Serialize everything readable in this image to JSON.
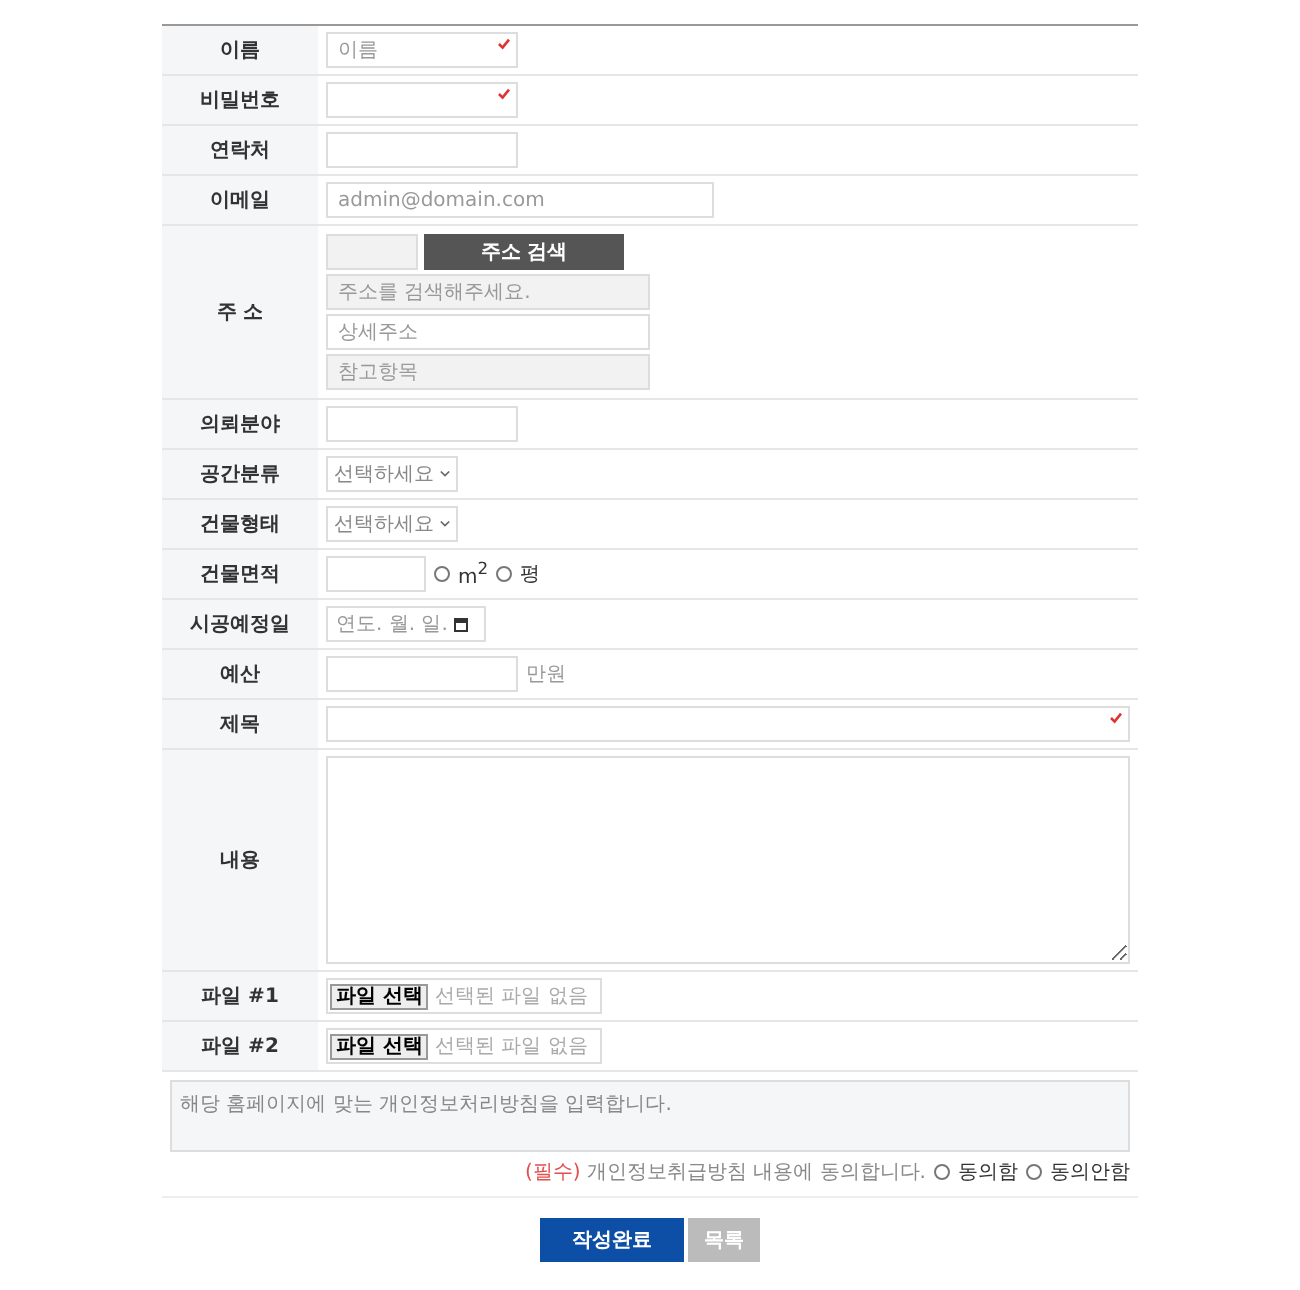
{
  "form_rows": [
    {
      "label": "이름",
      "kind": "text",
      "placeholder": "이름",
      "required": true
    },
    {
      "label": "비밀번호",
      "kind": "text",
      "required": true
    },
    {
      "label": "연락처",
      "kind": "text",
      "required": false
    },
    {
      "label": "이메일",
      "kind": "email",
      "placeholder": "admin@domain.com",
      "required": false
    },
    {
      "label": "주 소",
      "kind": "address",
      "button": "주소 검색",
      "fields": [
        {
          "placeholder": "주소를 검색해주세요.",
          "readonly": true
        },
        {
          "placeholder": "상세주소",
          "readonly": false
        },
        {
          "placeholder": "참고항목",
          "readonly": true
        }
      ]
    },
    {
      "label": "의뢰분야",
      "kind": "text",
      "required": false
    },
    {
      "label": "공간분류",
      "kind": "select",
      "value": "선택하세요"
    },
    {
      "label": "건물형태",
      "kind": "select",
      "value": "선택하세요"
    },
    {
      "label": "건물면적",
      "kind": "area",
      "options": [
        {
          "label": "m$^{2}$",
          "selected": false
        },
        {
          "label": "평",
          "selected": false
        }
      ]
    },
    {
      "label": "시공예정일",
      "kind": "date",
      "placeholder": "연도. 월. 일."
    },
    {
      "label": "예산",
      "kind": "budget",
      "unit": "만원"
    },
    {
      "label": "제목",
      "kind": "title",
      "required": true
    },
    {
      "label": "내용",
      "kind": "textarea"
    },
    {
      "label": "파일 #1",
      "kind": "file",
      "button": "파일 선택",
      "status": "선택된 파일 없음"
    },
    {
      "label": "파일 #2",
      "kind": "file",
      "button": "파일 선택",
      "status": "선택된 파일 없음"
    }
  ],
  "privacy": {
    "text": "해당 홈페이지에 맞는 개인정보처리방침을 입력합니다.",
    "required_tag": "(필수)",
    "agreement": "개인정보취급방침 내용에 동의합니다.",
    "options": [
      {
        "label": "동의함",
        "selected": false
      },
      {
        "label": "동의안함",
        "selected": false
      }
    ]
  },
  "buttons": [
    {
      "label": "작성완료",
      "kind": "primary"
    },
    {
      "label": "목록",
      "kind": "secondary"
    }
  ]
}
